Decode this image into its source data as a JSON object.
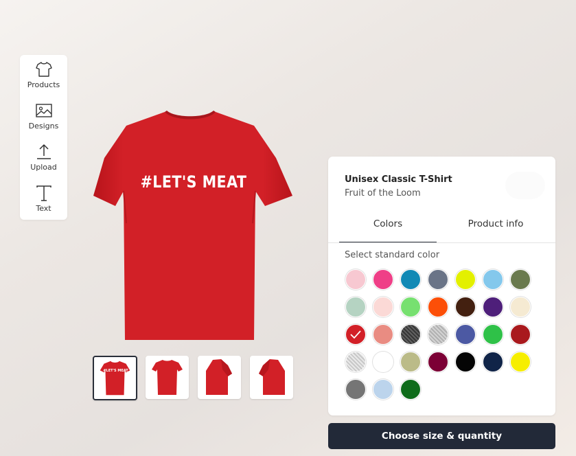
{
  "toolbar": {
    "items": [
      {
        "label": "Products",
        "icon": "tshirt-icon"
      },
      {
        "label": "Designs",
        "icon": "image-icon"
      },
      {
        "label": "Upload",
        "icon": "upload-icon"
      },
      {
        "label": "Text",
        "icon": "text-icon"
      }
    ]
  },
  "design": {
    "text": "#LET'S MEAT",
    "shirt_color": "#d22027"
  },
  "thumbnails": [
    {
      "view": "front",
      "selected": true,
      "text": "#LET'S MEAT"
    },
    {
      "view": "back",
      "selected": false
    },
    {
      "view": "left-sleeve",
      "selected": false
    },
    {
      "view": "right-sleeve",
      "selected": false
    }
  ],
  "product": {
    "title": "Unisex Classic T-Shirt",
    "brand": "Fruit of the Loom"
  },
  "tabs": {
    "colors": "Colors",
    "info": "Product info",
    "active": "colors"
  },
  "colors": {
    "label": "Select standard color",
    "selected_index": 14,
    "swatches": [
      "#f7c8d1",
      "#ef3f87",
      "#1189b5",
      "#6a7487",
      "#e3f000",
      "#84c8ec",
      "#6a7a4e",
      "#b5d3c2",
      "#fbd9d6",
      "#77e070",
      "#fc4f08",
      "#432010",
      "#4e1f7a",
      "#f5ead2",
      "#d22027",
      "#e98c82",
      "#3e3e3e",
      "#c9c9c9",
      "#4c59a3",
      "#2fc148",
      "#a9191d",
      "#e4e4e4",
      "#ffffff",
      "#bbbb88",
      "#7c0035",
      "#050505",
      "#102448",
      "#f6ee00",
      "#757575",
      "#bcd4ec",
      "#0f6c1b"
    ],
    "textured": [
      16,
      17,
      21
    ]
  },
  "cta": {
    "label": "Choose size & quantity"
  }
}
